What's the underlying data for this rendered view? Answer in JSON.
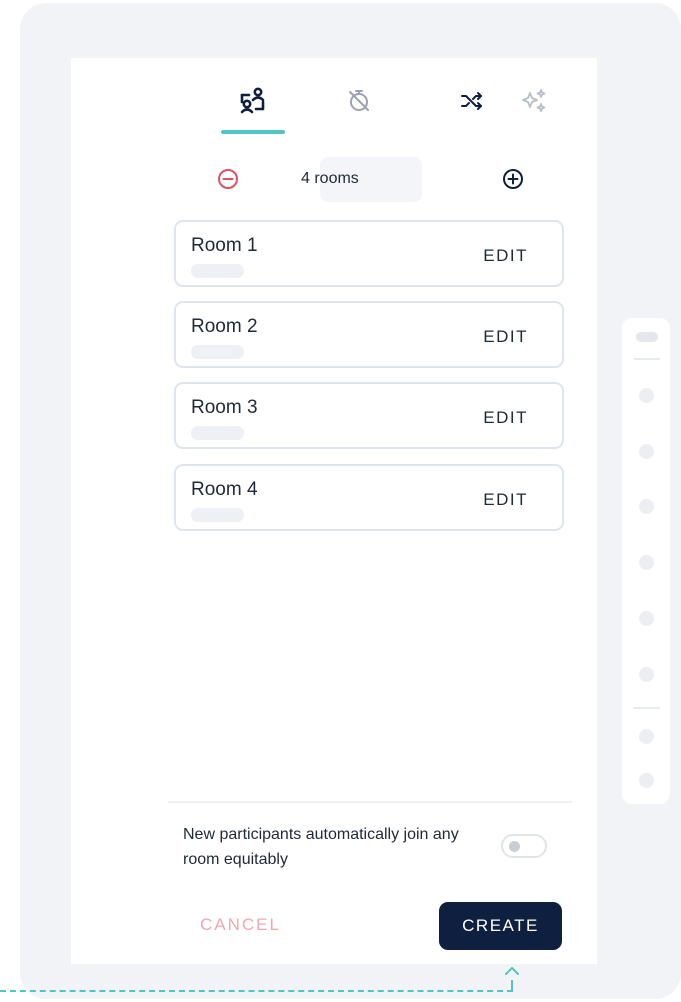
{
  "colors": {
    "accent": "#4fc7c0",
    "primary_dark": "#0e1f3f",
    "remove_red": "#e0525f",
    "cancel_pink": "#f1a7ae",
    "inactive_icon": "#9aa3b0"
  },
  "tabs": [
    {
      "icon": "breakout-rooms-icon",
      "active": true
    },
    {
      "icon": "timer-off-icon",
      "active": false
    },
    {
      "icon": "shuffle-icon",
      "active": false
    },
    {
      "icon": "sparkles-icon",
      "active": false
    }
  ],
  "stepper": {
    "count_label": "4 rooms",
    "remove_icon": "minus-circle-icon",
    "add_icon": "plus-circle-icon"
  },
  "rooms": [
    {
      "name": "Room 1",
      "action": "EDIT"
    },
    {
      "name": "Room 2",
      "action": "EDIT"
    },
    {
      "name": "Room 3",
      "action": "EDIT"
    },
    {
      "name": "Room 4",
      "action": "EDIT"
    }
  ],
  "footer": {
    "auto_join_text": "New participants automatically join any room equitably",
    "auto_join_enabled": false,
    "cancel_label": "CANCEL",
    "create_label": "CREATE"
  },
  "left_rail": {
    "active_icon": "breakout-rooms-icon"
  }
}
